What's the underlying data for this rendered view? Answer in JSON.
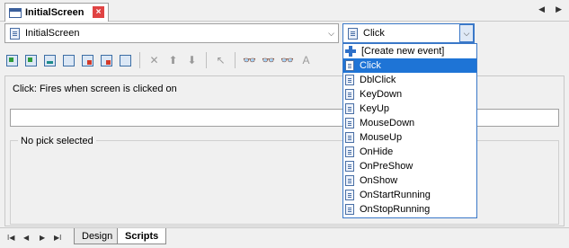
{
  "tab": {
    "title": "InitialScreen",
    "close": "×"
  },
  "nav": {
    "prev": "◀",
    "next": "▶"
  },
  "scene_combo": {
    "value": "InitialScreen",
    "arrow": "⌵"
  },
  "event_combo": {
    "value": "Click",
    "arrow": "⌵"
  },
  "description": "Click: Fires when screen is clicked on",
  "script_input": {
    "value": ""
  },
  "pick_group": {
    "label": "No pick selected"
  },
  "toolbar": {
    "icons": [
      "new-scene-icon",
      "add-layer-icon",
      "image-icon",
      "properties-icon",
      "cut-object-icon",
      "debug-icon",
      "print-icon",
      "delete-icon",
      "move-up-icon",
      "move-down-icon",
      "cursor-icon",
      "find-icon",
      "find-next-icon",
      "replace-icon",
      "text-icon"
    ],
    "delete_glyph": "✕",
    "up_glyph": "⬆",
    "down_glyph": "⬇",
    "cursor_glyph": "↖",
    "find_glyph": "👓",
    "text_glyph": "A"
  },
  "dropdown": {
    "items": [
      {
        "label": "[Create new event]",
        "icon": "plus-icon"
      },
      {
        "label": "Click",
        "icon": "script-icon",
        "selected": true
      },
      {
        "label": "DblClick",
        "icon": "script-icon"
      },
      {
        "label": "KeyDown",
        "icon": "script-icon"
      },
      {
        "label": "KeyUp",
        "icon": "script-icon"
      },
      {
        "label": "MouseDown",
        "icon": "script-icon"
      },
      {
        "label": "MouseUp",
        "icon": "script-icon"
      },
      {
        "label": "OnHide",
        "icon": "script-icon"
      },
      {
        "label": "OnPreShow",
        "icon": "script-icon"
      },
      {
        "label": "OnShow",
        "icon": "script-icon"
      },
      {
        "label": "OnStartRunning",
        "icon": "script-icon"
      },
      {
        "label": "OnStopRunning",
        "icon": "script-icon"
      }
    ]
  },
  "bottom_tabs": {
    "nav_first": "I◀",
    "nav_prev": "◀",
    "nav_next": "▶",
    "nav_last": "▶I",
    "design": "Design",
    "scripts": "Scripts"
  }
}
